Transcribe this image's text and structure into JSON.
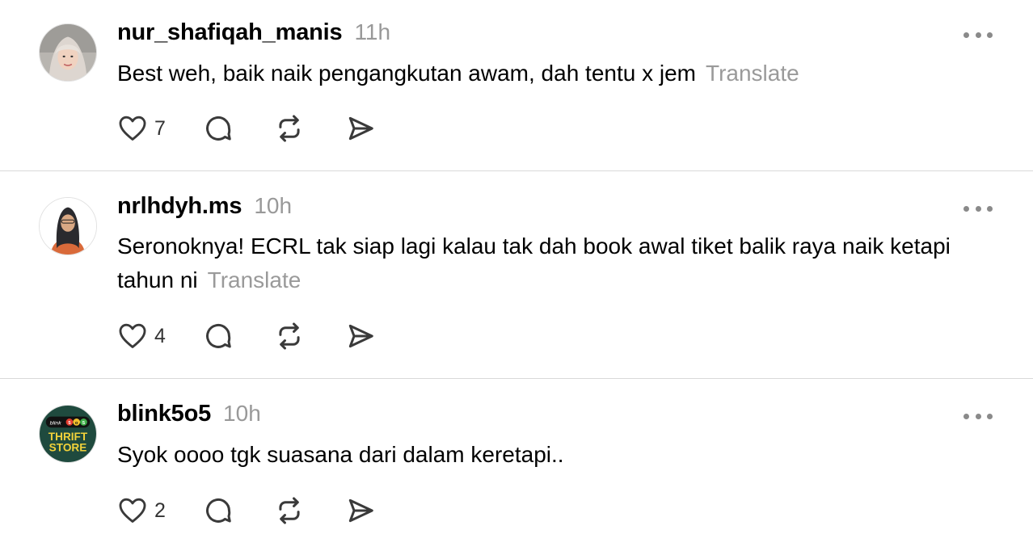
{
  "posts": [
    {
      "username": "nur_shafiqah_manis",
      "time": "11h",
      "text": "Best weh, baik naik pengangkutan awam, dah tentu x jem",
      "translate": "Translate",
      "likes": "7"
    },
    {
      "username": "nrlhdyh.ms",
      "time": "10h",
      "text": "Seronoknya! ECRL tak siap lagi kalau tak dah book awal tiket balik raya naik ketapi tahun ni",
      "translate": "Translate",
      "likes": "4"
    },
    {
      "username": "blink5o5",
      "time": "10h",
      "text": "Syok oooo tgk suasana dari dalam keretapi..",
      "likes": "2",
      "avatar_logo_text": [
        "blink",
        "5",
        "o",
        "5",
        "THRIFT",
        "STORE"
      ]
    }
  ],
  "icons": {
    "like": "heart-icon",
    "reply": "comment-icon",
    "repost": "repost-icon",
    "share": "send-icon",
    "more": "more-icon"
  },
  "colors": {
    "text": "#000000",
    "muted": "#999999",
    "icon": "#3a3a3a",
    "divider": "#d9d9d9"
  }
}
